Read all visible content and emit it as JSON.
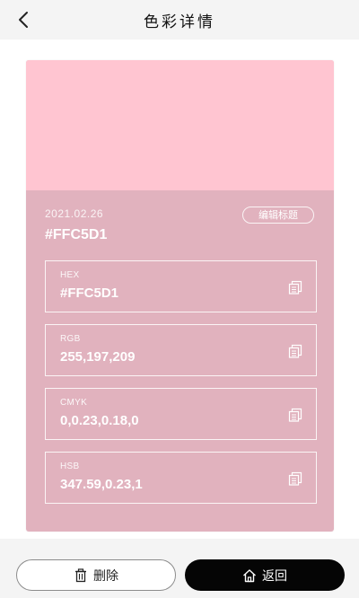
{
  "header": {
    "title": "色彩详情",
    "back_icon": "chevron-left-icon"
  },
  "card": {
    "swatch_color": "#FFC5D1",
    "panel_color": "#E1B2BE",
    "date": "2021.02.26",
    "edit_title_label": "编辑标题",
    "color_name": "#FFC5D1",
    "values": [
      {
        "label": "HEX",
        "value": "#FFC5D1",
        "copy_icon": "copy-icon"
      },
      {
        "label": "RGB",
        "value": "255,197,209",
        "copy_icon": "copy-icon"
      },
      {
        "label": "CMYK",
        "value": "0,0.23,0.18,0",
        "copy_icon": "copy-icon"
      },
      {
        "label": "HSB",
        "value": "347.59,0.23,1",
        "copy_icon": "copy-icon"
      }
    ]
  },
  "footer": {
    "delete_label": "删除",
    "delete_icon": "trash-icon",
    "back_label": "返回",
    "back_icon": "home-icon"
  }
}
